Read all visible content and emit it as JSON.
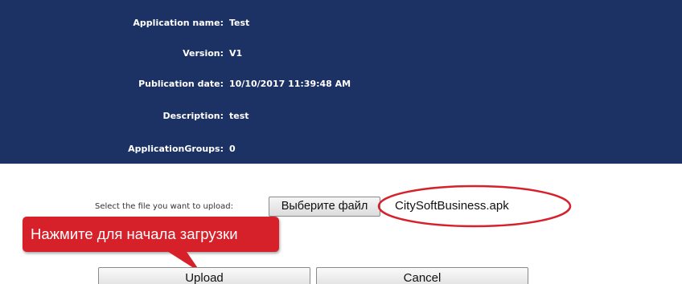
{
  "app_info": {
    "rows": [
      {
        "label": "Application name:",
        "value": "Test"
      },
      {
        "label": "Version:",
        "value": "V1"
      },
      {
        "label": "Publication date:",
        "value": "10/10/2017 11:39:48 AM"
      },
      {
        "label": "Description:",
        "value": "test"
      },
      {
        "label": "ApplicationGroups:",
        "value": "0"
      }
    ]
  },
  "upload": {
    "prompt": "Select the file you want to upload:",
    "choose_file_label": "Выберите файл",
    "selected_file": "CitySoftBusiness.apk"
  },
  "callout": {
    "text": "Нажмите для начала загрузки"
  },
  "actions": {
    "upload_label": "Upload",
    "cancel_label": "Cancel"
  },
  "colors": {
    "panel_background": "#1d3264",
    "callout_background": "#d6212b",
    "highlight_ring": "#d6212b"
  }
}
